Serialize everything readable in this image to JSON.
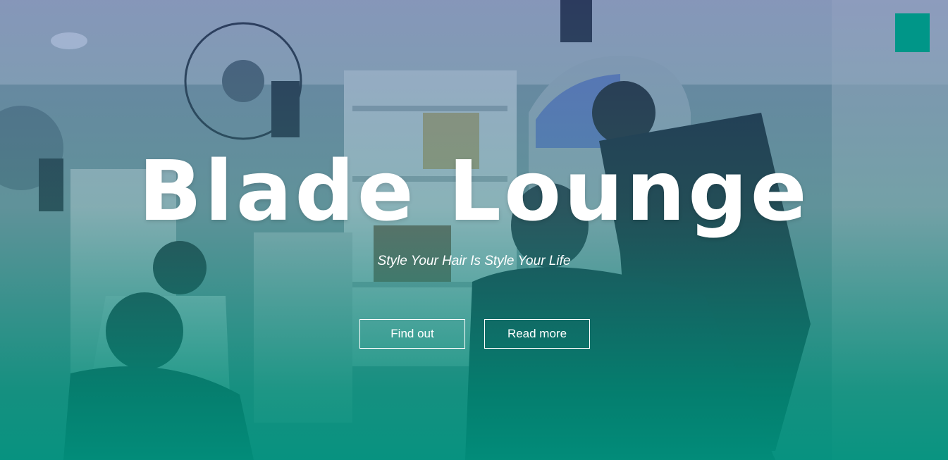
{
  "hero": {
    "title": "Blade Lounge",
    "tagline": "Style Your Hair Is Style Your Life",
    "buttons": {
      "find_out": "Find out",
      "read_more": "Read more"
    }
  },
  "menu": {
    "toggle_icon": "menu-icon",
    "toggle_color": "#009688"
  },
  "colors": {
    "accent": "#009688",
    "text": "#ffffff"
  }
}
